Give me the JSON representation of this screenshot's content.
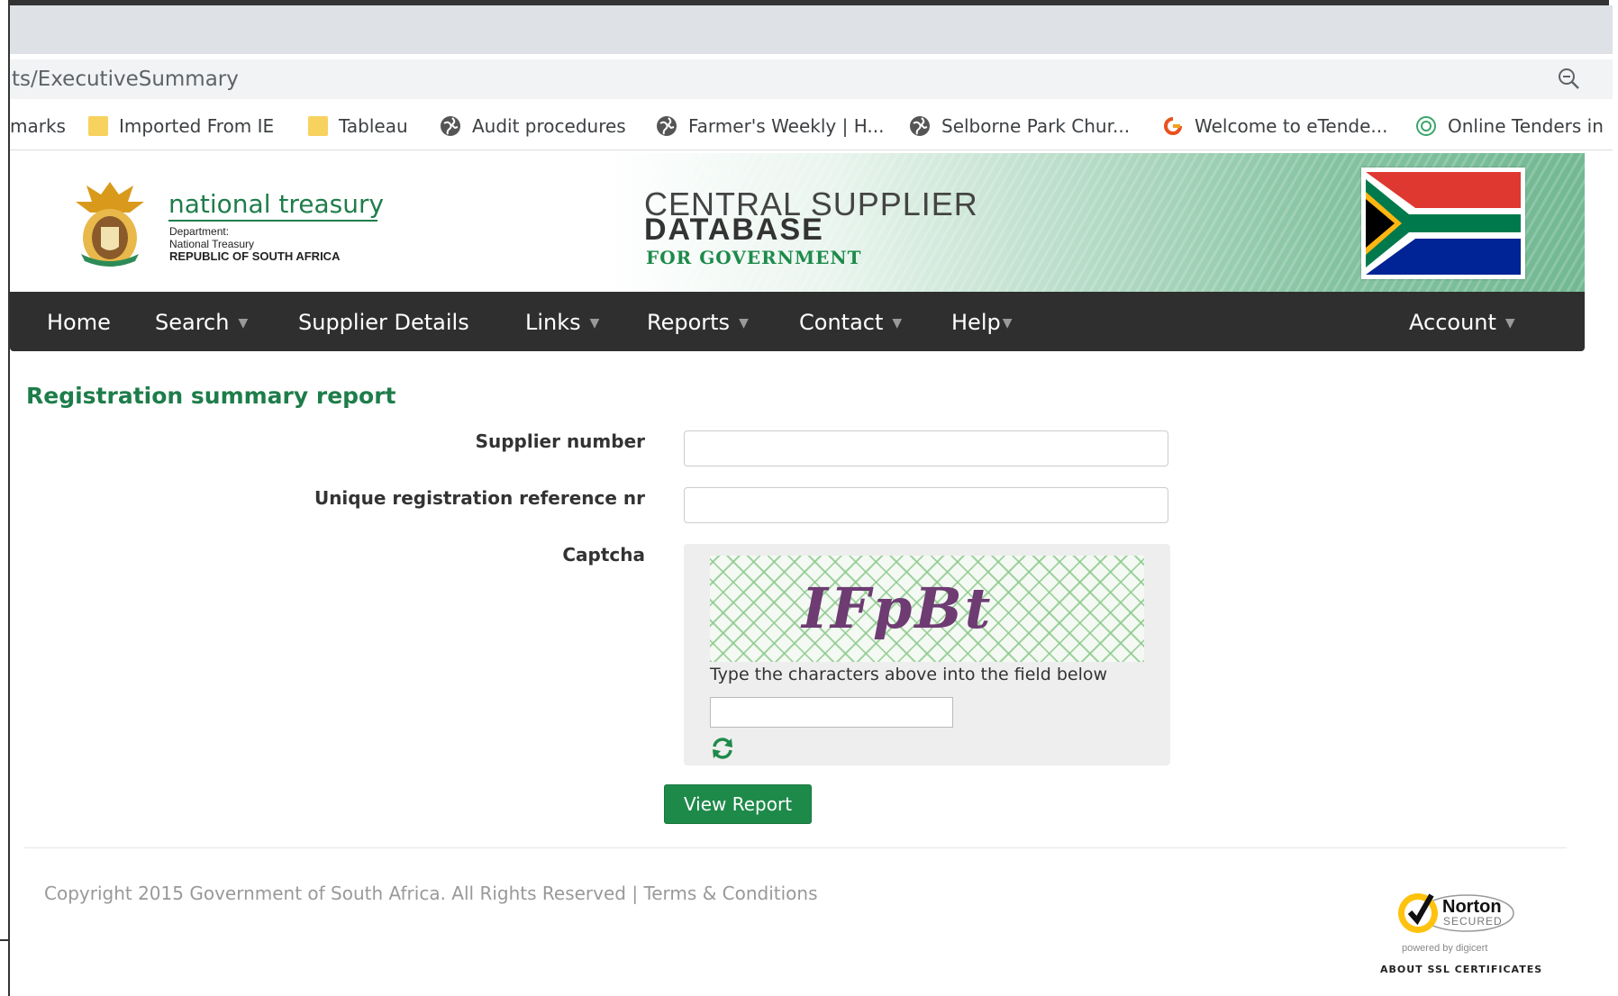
{
  "browser": {
    "url": "ts/ExecutiveSummary",
    "bookmarks": [
      {
        "label": "marks",
        "icon": "none"
      },
      {
        "label": "Imported From IE",
        "icon": "folder-icon"
      },
      {
        "label": "Tableau",
        "icon": "folder-icon"
      },
      {
        "label": "Audit procedures",
        "icon": "globe-icon"
      },
      {
        "label": "Farmer's Weekly | H...",
        "icon": "globe-icon"
      },
      {
        "label": "Selborne Park Chur...",
        "icon": "globe-icon"
      },
      {
        "label": "Welcome to eTende...",
        "icon": "etender-icon"
      },
      {
        "label": "Online Tenders in",
        "icon": "online-tenders-icon"
      }
    ]
  },
  "header": {
    "org_name": "national treasury",
    "org_sub1": "Department:",
    "org_sub2": "National Treasury",
    "org_sub3": "REPUBLIC OF SOUTH AFRICA",
    "title_line1": "CENTRAL SUPPLIER",
    "title_line2": "DATABASE",
    "title_line3": "FOR GOVERNMENT"
  },
  "nav": {
    "home": "Home",
    "search": "Search",
    "supplier_details": "Supplier Details",
    "links": "Links",
    "reports": "Reports",
    "contact": "Contact",
    "help": "Help",
    "account": "Account",
    "caret": "▼"
  },
  "form": {
    "title": "Registration summary report",
    "supplier_number_label": "Supplier number",
    "supplier_number_value": "",
    "unique_ref_label": "Unique registration reference nr",
    "unique_ref_value": "",
    "captcha_label": "Captcha",
    "captcha_text": "IFpBt",
    "captcha_hint": "Type the characters above into the field below",
    "captcha_value": "",
    "submit_label": "View Report"
  },
  "footer": {
    "copyright": "Copyright 2015 Government of South Africa. All Rights Reserved |",
    "terms": "Terms & Conditions",
    "norton_brand": "Norton",
    "norton_secured": "SECURED",
    "norton_powered": "powered by digicert",
    "ssl_link": "ABOUT SSL CERTIFICATES"
  },
  "colors": {
    "brand_green": "#1e7d4a",
    "nav_bg": "#2f2f2f",
    "button_green": "#1e8a4a"
  }
}
